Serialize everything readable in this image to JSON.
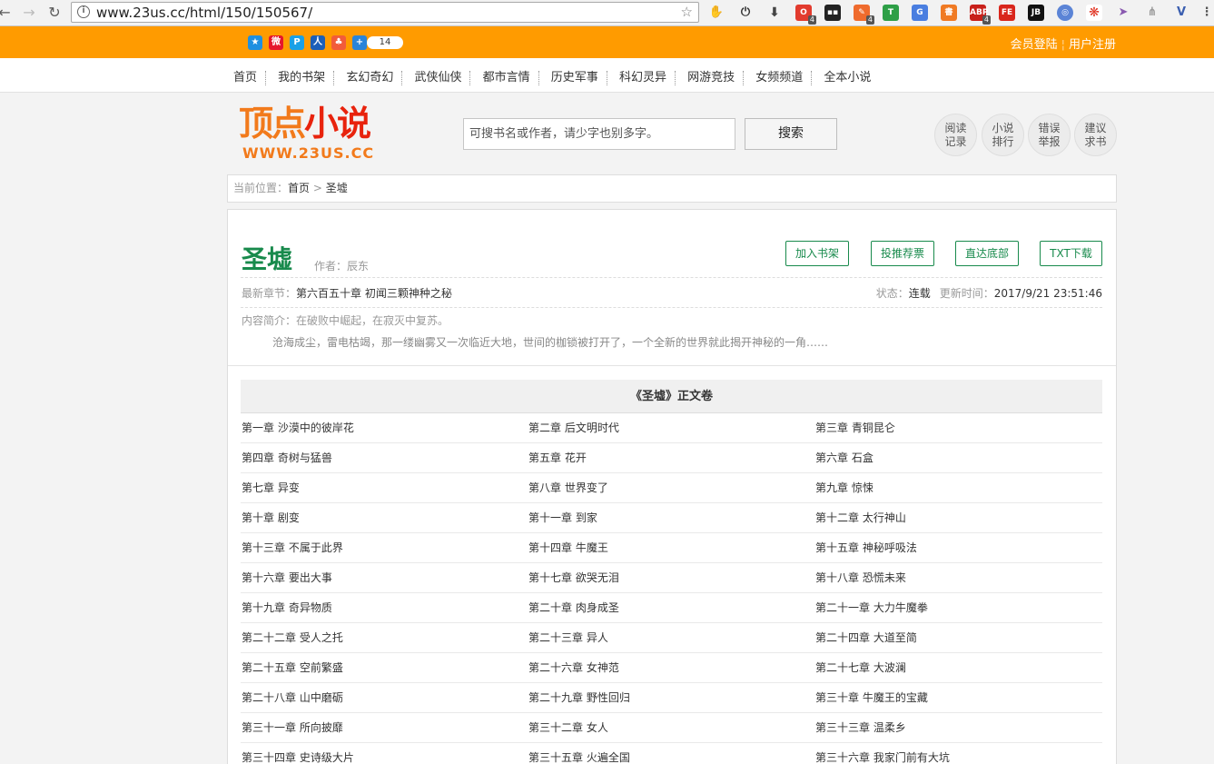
{
  "browser": {
    "url": "www.23us.cc/html/150/150567/",
    "extension_badges": [
      "4",
      "4",
      "4"
    ]
  },
  "topbar": {
    "share_count": "14",
    "login": "会员登陆",
    "register": "用户注册"
  },
  "nav": [
    "首页",
    "我的书架",
    "玄幻奇幻",
    "武侠仙侠",
    "都市言情",
    "历史军事",
    "科幻灵异",
    "网游竞技",
    "女频频道",
    "全本小说"
  ],
  "header": {
    "logo_text_a": "顶点",
    "logo_text_b": "小说",
    "logo_url": "WWW.23US.CC",
    "search_placeholder": "可搜书名或作者，请少字也别多字。",
    "search_button": "搜索",
    "circles": [
      {
        "line1": "阅读",
        "line2": "记录"
      },
      {
        "line1": "小说",
        "line2": "排行"
      },
      {
        "line1": "错误",
        "line2": "举报"
      },
      {
        "line1": "建议",
        "line2": "求书"
      }
    ]
  },
  "breadcrumb": {
    "label": "当前位置：",
    "home": "首页",
    "sep": " > ",
    "current": "圣墟"
  },
  "book": {
    "title": "圣墟",
    "author_label": "作者：",
    "author": "辰东",
    "buttons": [
      "加入书架",
      "投推荐票",
      "直达底部",
      "TXT下载"
    ],
    "latest_label": "最新章节：",
    "latest": "第六百五十章 初闻三颗神种之秘",
    "status_label": "状态：",
    "status": "连载",
    "update_label": "更新时间：",
    "update": "2017/9/21 23:51:46",
    "intro_label": "内容简介：",
    "intro_line1": "在破败中崛起，在寂灭中复苏。",
    "intro_line2": "沧海成尘，雷电枯竭，那一缕幽雾又一次临近大地，世间的枷锁被打开了，一个全新的世界就此揭开神秘的一角……"
  },
  "volume_title": "《圣墟》正文卷",
  "chapters": [
    "第一章 沙漠中的彼岸花",
    "第二章 后文明时代",
    "第三章 青铜昆仑",
    "第四章 奇树与猛兽",
    "第五章 花开",
    "第六章 石盒",
    "第七章 异变",
    "第八章 世界变了",
    "第九章 惊悚",
    "第十章 剧变",
    "第十一章 到家",
    "第十二章 太行神山",
    "第十三章 不属于此界",
    "第十四章 牛魔王",
    "第十五章 神秘呼吸法",
    "第十六章 要出大事",
    "第十七章 欲哭无泪",
    "第十八章 恐慌未来",
    "第十九章 奇异物质",
    "第二十章 肉身成圣",
    "第二十一章 大力牛魔拳",
    "第二十二章 受人之托",
    "第二十三章 异人",
    "第二十四章 大道至简",
    "第二十五章 空前繁盛",
    "第二十六章 女神范",
    "第二十七章 大波澜",
    "第二十八章 山中磨砺",
    "第二十九章 野性回归",
    "第三十章 牛魔王的宝藏",
    "第三十一章 所向披靡",
    "第三十二章 女人",
    "第三十三章 温柔乡",
    "第三十四章 史诗级大片",
    "第三十五章 火遍全国",
    "第三十六章 我家门前有大坑"
  ]
}
